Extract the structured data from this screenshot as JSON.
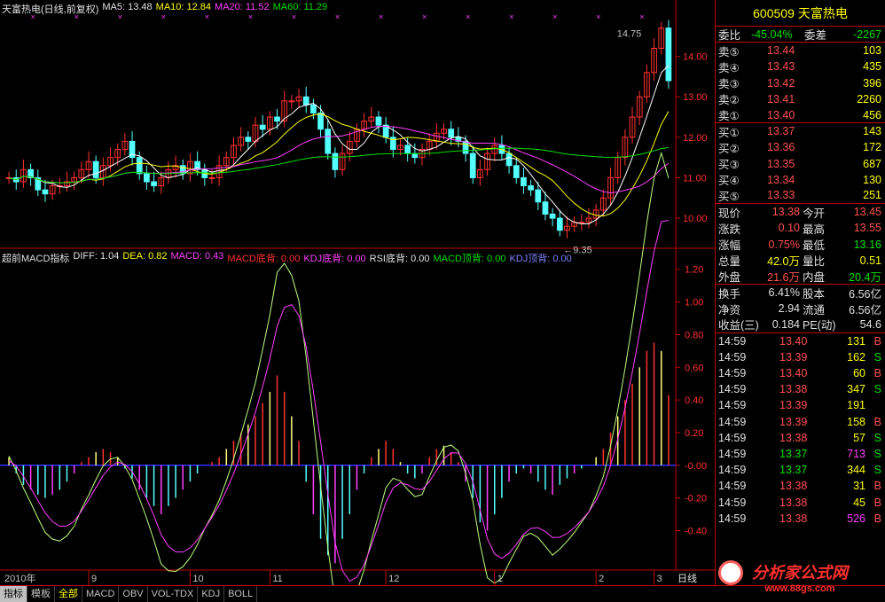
{
  "price_legend": {
    "title": "天富热电(日线,前复权)",
    "ma5": "MA5: 13.48",
    "ma10": "MA10: 12.84",
    "ma20": "MA20: 11.52",
    "ma60": "MA60: 11.29"
  },
  "macd_legend": {
    "title": "超前MACD指标",
    "diff": "DIFF: 1.04",
    "dea": "DEA: 0.82",
    "macd": "MACD: 0.43",
    "macd_bottom": "MACD底背: 0.00",
    "kdj_bottom": "KDJ底背: 0.00",
    "rsi_bottom": "RSI底背: 0.00",
    "macd_top": "MACD顶背: 0.00",
    "kdj_top": "KDJ顶背: 0.00"
  },
  "price_axis": [
    "14.00",
    "13.00",
    "12.00",
    "11.00",
    "10.00"
  ],
  "macd_axis": [
    "1.20",
    "1.00",
    "0.80",
    "0.60",
    "0.40",
    "0.20",
    "-0.00",
    "-0.20",
    "-0.40"
  ],
  "annotations": {
    "high": "14.75",
    "low": "9.35"
  },
  "date_axis": [
    "2010年",
    "9",
    "10",
    "11",
    "12",
    "1",
    "2",
    "3"
  ],
  "period_label": "日线",
  "quote": {
    "code": "600509",
    "name": "天富热电",
    "weibi_label": "委比",
    "weibi": "-45.04%",
    "weicha_label": "委差",
    "weicha": "-2267",
    "asks": [
      {
        "label": "卖⑤",
        "price": "13.44",
        "vol": "103"
      },
      {
        "label": "卖④",
        "price": "13.43",
        "vol": "435"
      },
      {
        "label": "卖③",
        "price": "13.42",
        "vol": "396"
      },
      {
        "label": "卖②",
        "price": "13.41",
        "vol": "2260"
      },
      {
        "label": "卖①",
        "price": "13.40",
        "vol": "456"
      }
    ],
    "bids": [
      {
        "label": "买①",
        "price": "13.37",
        "vol": "143"
      },
      {
        "label": "买②",
        "price": "13.36",
        "vol": "172"
      },
      {
        "label": "买③",
        "price": "13.35",
        "vol": "687"
      },
      {
        "label": "买④",
        "price": "13.34",
        "vol": "130"
      },
      {
        "label": "买⑤",
        "price": "13.33",
        "vol": "251"
      }
    ],
    "stats": [
      {
        "l1": "现价",
        "v1": "13.38",
        "l2": "今开",
        "v2": "13.45"
      },
      {
        "l1": "涨跌",
        "v1": "0.10",
        "l2": "最高",
        "v2": "13.55"
      },
      {
        "l1": "涨幅",
        "v1": "0.75%",
        "l2": "最低",
        "v2": "13.16"
      },
      {
        "l1": "总量",
        "v1": "42.0万",
        "l2": "量比",
        "v2": "0.51"
      },
      {
        "l1": "外盘",
        "v1": "21.6万",
        "l2": "内盘",
        "v2": "20.4万"
      }
    ],
    "stats2": [
      {
        "l1": "换手",
        "v1": "6.41%",
        "l2": "股本",
        "v2": "6.56亿"
      },
      {
        "l1": "净资",
        "v1": "2.94",
        "l2": "流通",
        "v2": "6.56亿"
      },
      {
        "l1": "收益(三)",
        "v1": "0.184",
        "l2": "PE(动)",
        "v2": "54.6"
      }
    ],
    "ticks": [
      {
        "time": "14:59",
        "price": "13.40",
        "vol": "131",
        "bs": "B"
      },
      {
        "time": "14:59",
        "price": "13.39",
        "vol": "162",
        "bs": "S"
      },
      {
        "time": "14:59",
        "price": "13.40",
        "vol": "60",
        "bs": "B"
      },
      {
        "time": "14:59",
        "price": "13.38",
        "vol": "347",
        "bs": "S"
      },
      {
        "time": "14:59",
        "price": "13.39",
        "vol": "191",
        "bs": ""
      },
      {
        "time": "14:59",
        "price": "13.39",
        "vol": "158",
        "bs": "B"
      },
      {
        "time": "14:59",
        "price": "13.38",
        "vol": "57",
        "bs": "S"
      },
      {
        "time": "14:59",
        "price": "13.37",
        "vol": "713",
        "bs": "S"
      },
      {
        "time": "14:59",
        "price": "13.37",
        "vol": "344",
        "bs": "S"
      },
      {
        "time": "14:59",
        "price": "13.38",
        "vol": "31",
        "bs": "B"
      },
      {
        "time": "14:59",
        "price": "13.38",
        "vol": "45",
        "bs": "B"
      },
      {
        "time": "14:59",
        "price": "13.38",
        "vol": "526",
        "bs": "B"
      }
    ]
  },
  "bottom_tabs": [
    "指标",
    "模板",
    "全部",
    "MACD",
    "OBV",
    "VOL-TDX",
    "KDJ",
    "BOLL"
  ],
  "watermark": {
    "text1": "分析家公式网",
    "text2": "www.88gs.com"
  },
  "colors": {
    "up": "#ff3030",
    "down": "#54ffff",
    "ma5": "#ffffff",
    "ma10": "#ffff00",
    "ma20": "#ff40ff",
    "ma60": "#00e000",
    "grid": "#c00000"
  },
  "chart_data": [
    {
      "type": "candlestick",
      "title": "天富热电(日线,前复权)",
      "series": [
        {
          "name": "MA5",
          "values_last": 13.48
        },
        {
          "name": "MA10",
          "values_last": 12.84
        },
        {
          "name": "MA20",
          "values_last": 11.52
        },
        {
          "name": "MA60",
          "values_last": 11.29
        }
      ],
      "close": [
        11.0,
        10.9,
        11.2,
        11.0,
        10.7,
        10.6,
        10.8,
        10.8,
        10.9,
        11.0,
        11.2,
        11.4,
        11.0,
        11.3,
        11.5,
        11.7,
        11.9,
        11.5,
        11.1,
        10.9,
        10.8,
        11.0,
        11.2,
        11.3,
        11.1,
        11.4,
        11.2,
        11.0,
        11.0,
        11.3,
        11.5,
        11.8,
        12.0,
        11.9,
        12.3,
        12.2,
        12.5,
        12.4,
        12.9,
        12.9,
        13.0,
        12.8,
        12.6,
        12.2,
        11.6,
        11.2,
        11.6,
        11.9,
        12.2,
        12.4,
        12.5,
        12.3,
        12.0,
        11.7,
        11.8,
        11.6,
        11.5,
        11.7,
        11.9,
        12.1,
        12.2,
        12.0,
        11.9,
        11.6,
        11.0,
        11.2,
        11.6,
        11.8,
        11.6,
        11.3,
        11.0,
        10.8,
        10.7,
        10.4,
        10.1,
        10.0,
        9.7,
        9.8,
        9.9,
        9.9,
        10.0,
        10.2,
        10.5,
        11.0,
        11.5,
        12.0,
        12.5,
        13.0,
        13.6,
        14.2,
        14.7,
        13.4
      ],
      "ylim": [
        9.35,
        14.75
      ],
      "yticks": [
        10.0,
        11.0,
        12.0,
        13.0,
        14.0
      ],
      "annotations": [
        "14.75",
        "9.35"
      ]
    },
    {
      "type": "bar",
      "title": "超前MACD指标",
      "series": [
        {
          "name": "DIFF",
          "values_last": 1.04
        },
        {
          "name": "DEA",
          "values_last": 0.82
        },
        {
          "name": "MACD",
          "values_last": 0.43
        }
      ],
      "macd": [
        0.05,
        -0.05,
        -0.12,
        -0.15,
        -0.18,
        -0.2,
        -0.18,
        -0.15,
        -0.1,
        -0.05,
        0.02,
        0.05,
        0.08,
        0.1,
        0.08,
        0.05,
        -0.02,
        -0.08,
        -0.15,
        -0.2,
        -0.25,
        -0.3,
        -0.25,
        -0.2,
        -0.15,
        -0.1,
        -0.05,
        0.0,
        0.02,
        0.05,
        0.1,
        0.15,
        0.2,
        0.25,
        0.3,
        0.38,
        0.45,
        0.55,
        0.45,
        0.3,
        0.15,
        -0.1,
        -0.3,
        -0.45,
        -0.55,
        -0.6,
        -0.45,
        -0.3,
        -0.15,
        -0.05,
        0.05,
        0.1,
        0.15,
        0.1,
        0.02,
        -0.05,
        -0.08,
        -0.05,
        0.05,
        0.1,
        0.12,
        0.08,
        0.02,
        -0.1,
        -0.2,
        -0.35,
        -0.4,
        -0.3,
        -0.2,
        -0.1,
        -0.05,
        -0.02,
        -0.05,
        -0.1,
        -0.15,
        -0.18,
        -0.12,
        -0.08,
        -0.05,
        -0.02,
        0.0,
        0.05,
        0.1,
        0.2,
        0.3,
        0.4,
        0.5,
        0.6,
        0.7,
        0.75,
        0.7,
        0.43
      ],
      "ylim": [
        -0.6,
        1.25
      ],
      "yticks": [
        -0.4,
        -0.2,
        0.0,
        0.2,
        0.4,
        0.6,
        0.8,
        1.0,
        1.2
      ]
    }
  ]
}
